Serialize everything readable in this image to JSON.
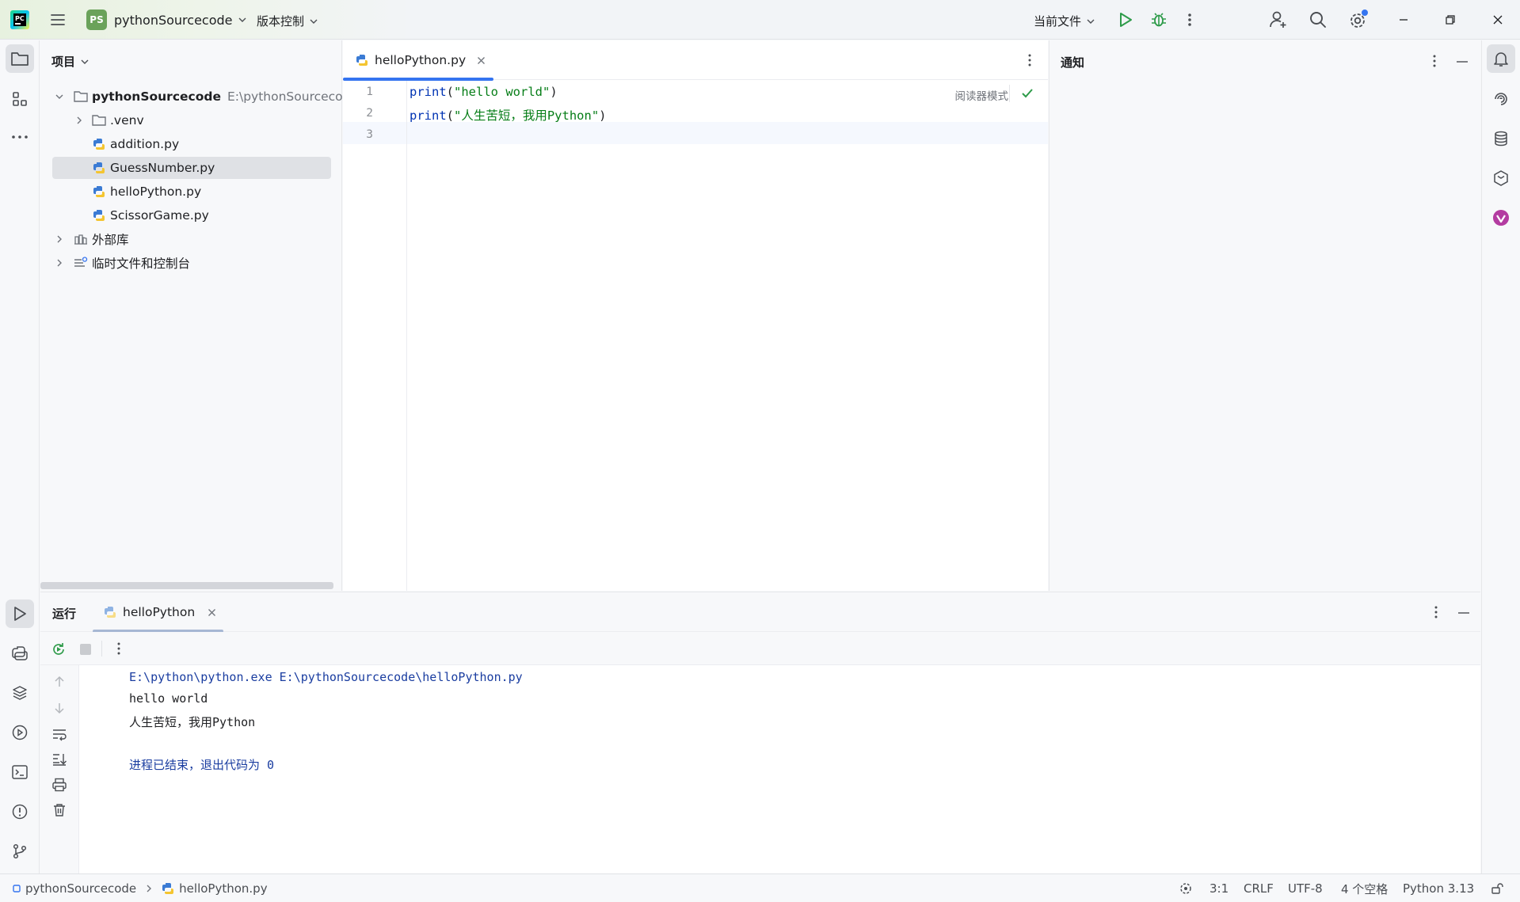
{
  "titlebar": {
    "project_badge": "PS",
    "project_name": "pythonSourcecode",
    "vcs_label": "版本控制",
    "run_config": "当前文件"
  },
  "project_panel": {
    "title": "项目",
    "tree": [
      {
        "label": "pythonSourcecode",
        "hint": "E:\\pythonSourcecode",
        "type": "root"
      },
      {
        "label": ".venv",
        "type": "folder"
      },
      {
        "label": "addition.py",
        "type": "python"
      },
      {
        "label": "GuessNumber.py",
        "type": "python",
        "selected": true
      },
      {
        "label": "helloPython.py",
        "type": "python"
      },
      {
        "label": "ScissorGame.py",
        "type": "python"
      },
      {
        "label": "外部库",
        "type": "library"
      },
      {
        "label": "临时文件和控制台",
        "type": "scratch"
      }
    ]
  },
  "editor": {
    "tab_label": "helloPython.py",
    "reader_mode": "阅读器模式",
    "line_numbers": [
      "1",
      "2",
      "3"
    ],
    "lines": [
      {
        "fn": "print",
        "open": "(",
        "str": "\"hello world\"",
        "close": ")"
      },
      {
        "fn": "print",
        "open": "(",
        "str": "\"人生苦短，我用Python\"",
        "close": ")"
      }
    ]
  },
  "notifications": {
    "title": "通知"
  },
  "run_panel": {
    "title": "运行",
    "tab_label": "helloPython",
    "output": [
      "E:\\python\\python.exe E:\\pythonSourcecode\\helloPython.py",
      "hello world",
      "人生苦短，我用Python",
      "进程已结束，退出代码为 0"
    ]
  },
  "statusbar": {
    "breadcrumb_project": "pythonSourcecode",
    "breadcrumb_file": "helloPython.py",
    "position": "3:1",
    "line_separator": "CRLF",
    "encoding": "UTF-8",
    "indent": "4 个空格",
    "interpreter": "Python 3.13"
  },
  "colors": {
    "accent": "#3574f0",
    "run_green": "#2e9b4a",
    "string_green": "#067d17",
    "keyword_blue": "#0033b3"
  }
}
